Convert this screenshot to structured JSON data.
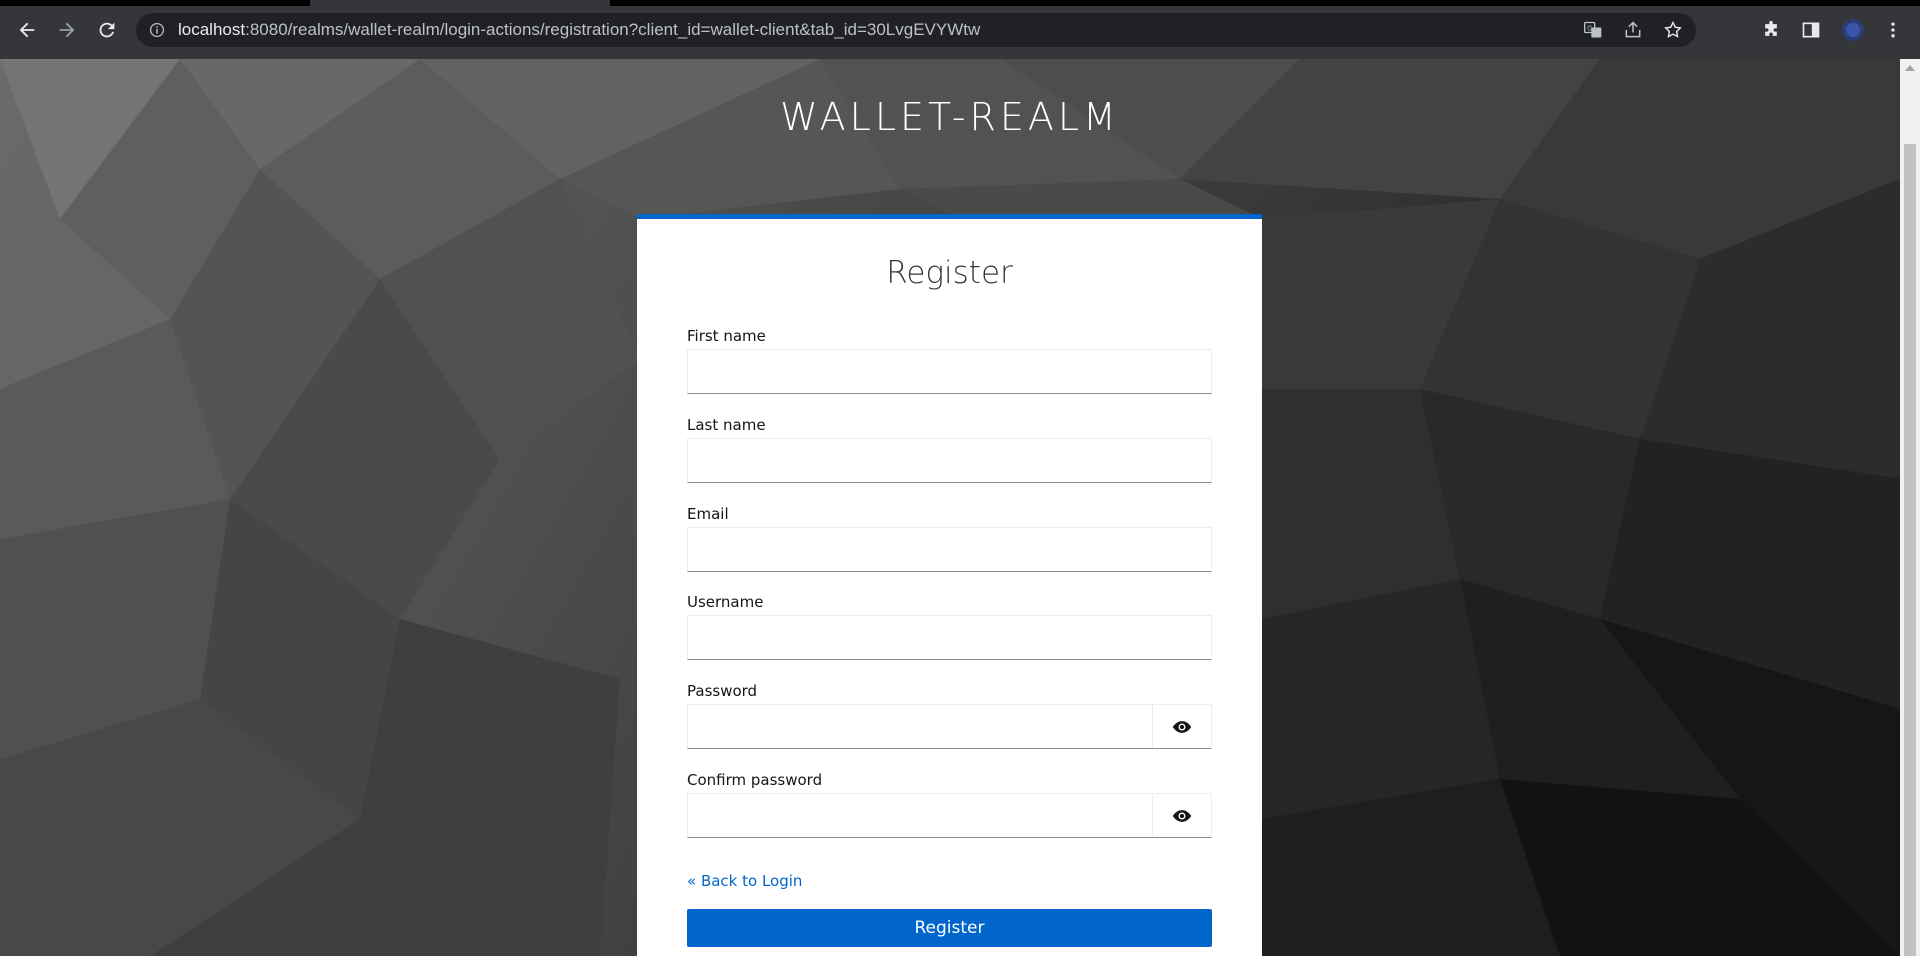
{
  "browser": {
    "url_host": "localhost",
    "url_rest": ":8080/realms/wallet-realm/login-actions/registration?client_id=wallet-client&tab_id=30LvgEVYWtw"
  },
  "page": {
    "realm_title": "WALLET-REALM",
    "form_title": "Register",
    "fields": {
      "first_name": {
        "label": "First name",
        "value": ""
      },
      "last_name": {
        "label": "Last name",
        "value": ""
      },
      "email": {
        "label": "Email",
        "value": ""
      },
      "username": {
        "label": "Username",
        "value": ""
      },
      "password": {
        "label": "Password",
        "value": ""
      },
      "confirm_password": {
        "label": "Confirm password",
        "value": ""
      }
    },
    "back_to_login": "« Back to Login",
    "register_button": "Register"
  },
  "colors": {
    "accent": "#0066cc",
    "chrome_bg": "#35363a",
    "omnibox_bg": "#202124"
  }
}
